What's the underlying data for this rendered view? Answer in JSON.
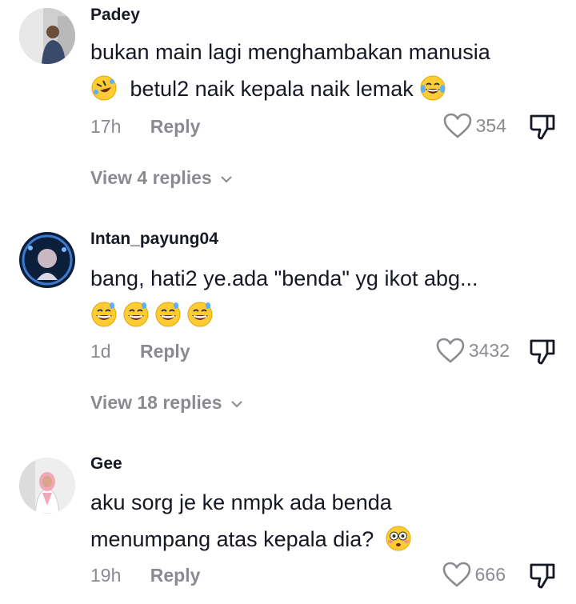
{
  "comments": [
    {
      "username": "Padey",
      "line1": "bukan main lagi menghambakan manusia",
      "line2": "betul2 naik kepala naik lemak",
      "time": "17h",
      "reply_label": "Reply",
      "likes": "354",
      "view_replies": "View 4 replies"
    },
    {
      "username": "Intan_payung04",
      "line1": "bang, hati2 ye.ada \"benda\" yg ikot abg...",
      "time": "1d",
      "reply_label": "Reply",
      "likes": "3432",
      "view_replies": "View 18 replies"
    },
    {
      "username": "Gee",
      "line1": "aku sorg je ke nmpk ada benda",
      "line2": "menumpang atas kepala dia?",
      "time": "19h",
      "reply_label": "Reply",
      "likes": "666"
    }
  ],
  "colors": {
    "text": "#161823",
    "muted": "#8a8b91",
    "emoji": "#ffcc33"
  },
  "icons": [
    "heart-icon",
    "thumbs-down-icon",
    "chevron-down-icon",
    "rolling-laughing-emoji",
    "grinning-sweat-emoji",
    "flushed-emoji"
  ]
}
